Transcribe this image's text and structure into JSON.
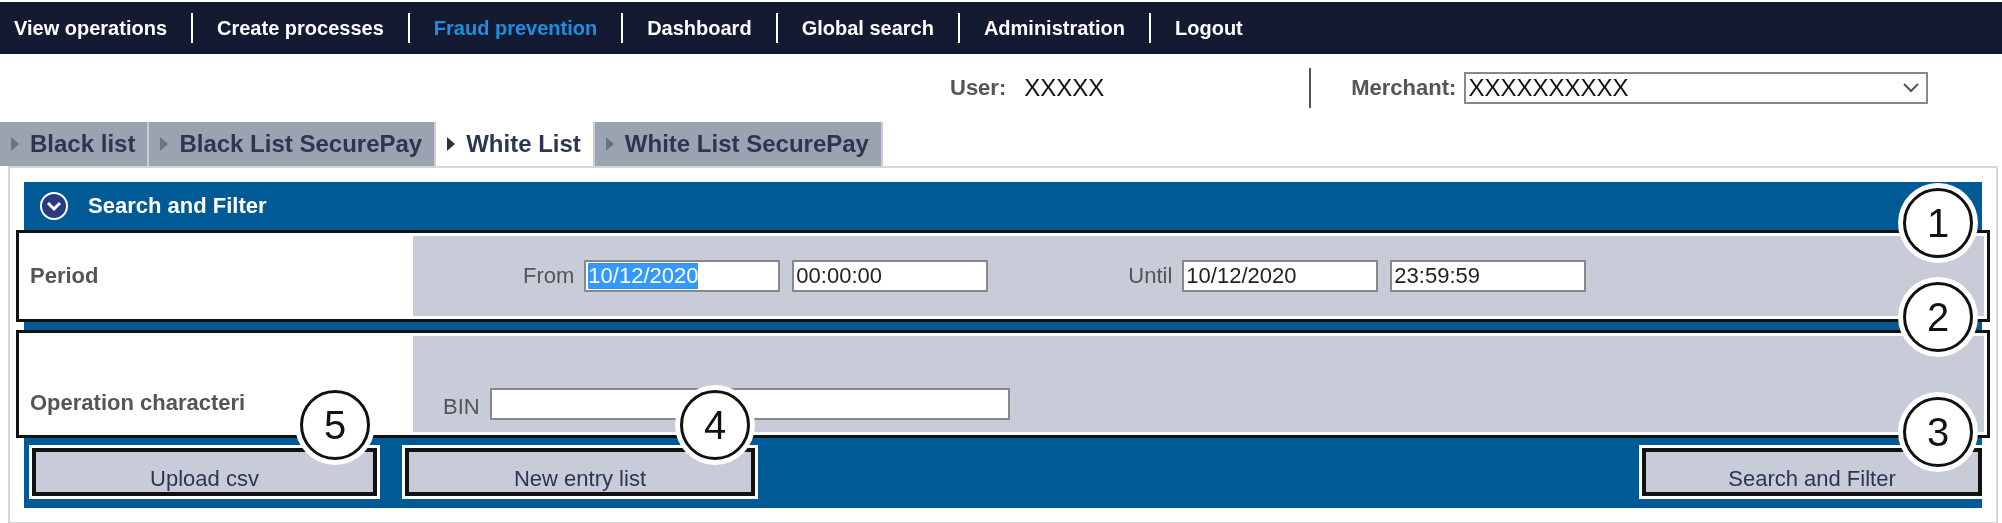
{
  "nav": {
    "items": [
      {
        "label": "View operations",
        "selected": false
      },
      {
        "label": "Create processes",
        "selected": false
      },
      {
        "label": "Fraud prevention",
        "selected": true
      },
      {
        "label": "Dashboard",
        "selected": false
      },
      {
        "label": "Global search",
        "selected": false
      },
      {
        "label": "Administration",
        "selected": false
      },
      {
        "label": "Logout",
        "selected": false
      }
    ]
  },
  "user": {
    "label": "User:",
    "value": "XXXXX"
  },
  "merchant": {
    "label": "Merchant:",
    "value": "XXXXXXXXXX"
  },
  "tabs": [
    {
      "label": "Black list",
      "selected": false
    },
    {
      "label": "Black List SecurePay",
      "selected": false
    },
    {
      "label": "White List",
      "selected": true
    },
    {
      "label": "White List SecurePay",
      "selected": false
    }
  ],
  "panel": {
    "title": "Search and Filter",
    "expanded": true
  },
  "period": {
    "label": "Period",
    "groups": [
      {
        "label": "From",
        "date": "10/12/2020",
        "date_highlighted": true,
        "time": "00:00:00"
      },
      {
        "label": "Until",
        "date": "10/12/2020",
        "date_highlighted": false,
        "time": "23:59:59"
      }
    ]
  },
  "characteristics": {
    "label": "Operation characteri",
    "bin": {
      "label": "BIN"
    }
  },
  "buttons": [
    {
      "label": "Upload csv"
    },
    {
      "label": "New entry list"
    },
    {
      "label": "Search and Filter"
    }
  ],
  "annotations": [
    "1",
    "2",
    "5",
    "4",
    "3"
  ]
}
